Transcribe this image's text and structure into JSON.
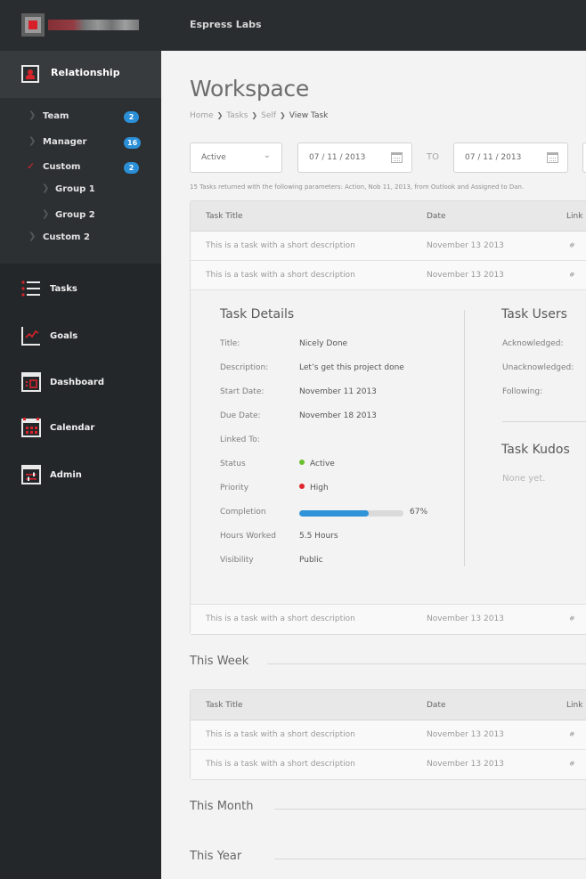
{
  "topbar": {
    "org_name": "Espress Labs"
  },
  "sidebar": {
    "relationship_label": "Relationship",
    "tree": [
      {
        "label": "Team",
        "badge": "2",
        "expanded": false,
        "level": 0
      },
      {
        "label": "Manager",
        "badge": "16",
        "expanded": false,
        "level": 0
      },
      {
        "label": "Custom",
        "badge": "2",
        "expanded": true,
        "level": 0
      },
      {
        "label": "Group 1",
        "badge": null,
        "expanded": false,
        "level": 1
      },
      {
        "label": "Group 2",
        "badge": null,
        "expanded": false,
        "level": 1
      },
      {
        "label": "Custom 2",
        "badge": null,
        "expanded": false,
        "level": 0
      }
    ],
    "nav": [
      {
        "label": "Tasks",
        "icon": "list-icon"
      },
      {
        "label": "Goals",
        "icon": "line-chart-icon"
      },
      {
        "label": "Dashboard",
        "icon": "dashboard-icon"
      },
      {
        "label": "Calendar",
        "icon": "calendar-icon"
      },
      {
        "label": "Admin",
        "icon": "admin-icon"
      }
    ],
    "accent_color": "#d8232a",
    "badge_color": "#2b8fd7"
  },
  "main": {
    "title": "Workspace",
    "breadcrumb": [
      "Home",
      "Tasks",
      "Self",
      "View Task"
    ],
    "filters": {
      "status_value": "Active",
      "from_date": "07 / 11 / 2013",
      "to_label": "TO",
      "to_date": "07 / 11 / 2013"
    },
    "result_note": "15 Tasks returned with the following parameters: Action, Nob 11, 2013, from Outlook and Assigned to Dan.",
    "table_headers": {
      "title": "Task Title",
      "date": "Date",
      "link": "Link"
    },
    "rows_top": [
      {
        "title": "This is a task with a short description",
        "date": "November 13 2013"
      },
      {
        "title": "This is a task with a short description",
        "date": "November 13 2013"
      }
    ],
    "details": {
      "heading": "Task Details",
      "fields": {
        "title_label": "Title:",
        "title_value": "Nicely Done",
        "desc_label": "Description:",
        "desc_value": "Let’s get this project done",
        "start_label": "Start Date:",
        "start_value": "November 11 2013",
        "due_label": "Due Date:",
        "due_value": "November 18 2013",
        "linked_label": "Linked To:",
        "linked_value": "",
        "status_label": "Status",
        "status_value": "Active",
        "status_color": "#6abf2e",
        "priority_label": "Priority",
        "priority_value": "High",
        "priority_color": "#e0262d",
        "completion_label": "Completion",
        "completion_percent": 67,
        "completion_text": "67%",
        "hours_label": "Hours Worked",
        "hours_value": "5.5 Hours",
        "visibility_label": "Visibility",
        "visibility_value": "Public"
      },
      "users_heading": "Task Users",
      "users": [
        "Acknowledged:",
        "Unacknowledged:",
        "Following:"
      ],
      "kudos_heading": "Task Kudos",
      "kudos_empty": "None yet."
    },
    "rows_after": [
      {
        "title": "This is a task with a short description",
        "date": "November 13 2013"
      }
    ],
    "this_week": {
      "heading": "This Week",
      "rows": [
        {
          "title": "This is a task with a short description",
          "date": "November 13 2013"
        },
        {
          "title": "This is a task with a short description",
          "date": "November 13 2013"
        }
      ]
    },
    "this_month_heading": "This Month",
    "this_year_heading": "This Year"
  }
}
